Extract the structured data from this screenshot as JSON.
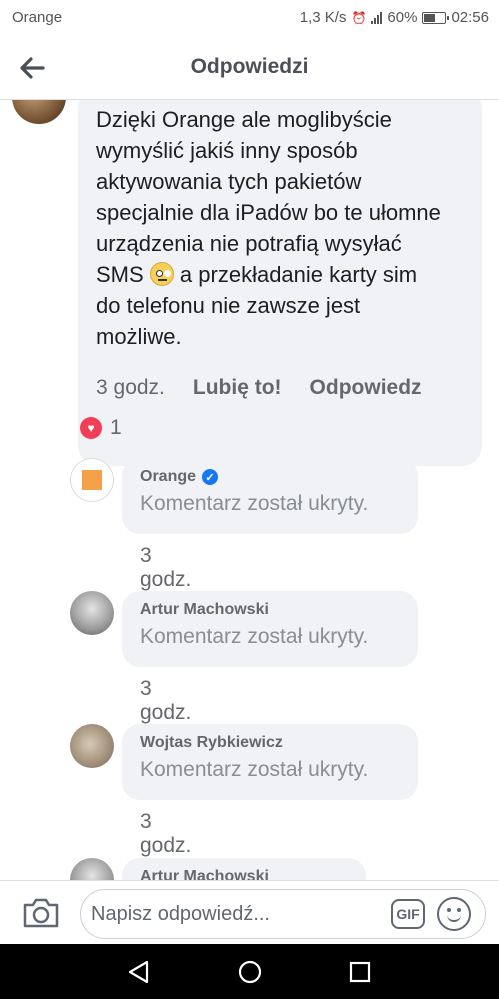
{
  "status_bar": {
    "carrier": "Orange",
    "speed": "1,3 K/s",
    "battery": "60%",
    "battery_level": 0.6,
    "time": "02:56"
  },
  "header": {
    "title": "Odpowiedzi",
    "back_icon": "arrow-left-icon"
  },
  "main_comment": {
    "text_before_emoji": "Dzięki Orange ale moglibyście\nwymyślić jakiś inny sposób\naktywowania tych pakietów\nspecjalnie dla iPadów bo te ułomne\nurządzenia nie potrafią wysyłać\nSMS",
    "text_after_emoji": " a przekładanie karty sim\ndo telefonu nie zawsze jest\nmożliwe.",
    "emoji": "rolling-eyes-emoji",
    "time": "3 godz.",
    "like_label": "Lubię to!",
    "reply_label": "Odpowiedz",
    "reaction_count": "1",
    "reaction_icon": "heart-icon"
  },
  "replies": [
    {
      "name": "Orange",
      "verified": true,
      "text": "Komentarz został ukryty.",
      "time": "3 godz."
    },
    {
      "name": "Artur Machowski",
      "verified": false,
      "text": "Komentarz został ukryty.",
      "time": "3 godz."
    },
    {
      "name": "Wojtas Rybkiewicz",
      "verified": false,
      "text": "Komentarz został ukryty.",
      "time": "3 godz."
    },
    {
      "name": "Artur Machowski",
      "verified": false,
      "text": "",
      "time": ""
    }
  ],
  "input_bar": {
    "placeholder": "Napisz odpowiedź...",
    "gif_label": "GIF",
    "camera_icon": "camera-icon",
    "emoji_icon": "smiley-icon"
  },
  "nav_bar": {
    "back_icon": "triangle-back-icon",
    "home_icon": "circle-home-icon",
    "recent_icon": "square-recent-icon"
  }
}
